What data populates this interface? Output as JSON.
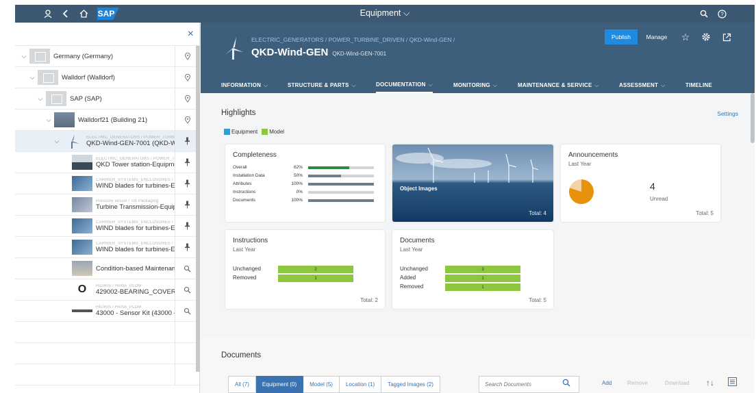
{
  "shell": {
    "title": "Equipment",
    "logo": "SAP",
    "icons": [
      "user-icon",
      "back-icon",
      "home-icon",
      "search-icon",
      "help-icon"
    ]
  },
  "tree": {
    "close": "×",
    "rows": [
      {
        "sub": "",
        "label": "Germany (Germany)",
        "action": "location-pin-icon"
      },
      {
        "sub": "",
        "label": "Walldorf (Walldorf)",
        "action": "location-pin-icon"
      },
      {
        "sub": "",
        "label": "SAP (SAP)",
        "action": "location-pin-icon"
      },
      {
        "sub": "",
        "label": "Walldorf21 (Building 21)",
        "action": "location-pin-icon"
      },
      {
        "sub": "ELECTRIC_GENERATORS / POWER_TURBI",
        "label": "QKD-Wind-GEN-7001 (QKD-Wi",
        "action": "unpin-icon"
      },
      {
        "sub": "ELECTRIC_GENERATORS / POWER_TUR",
        "label": "QKD Tower station-Equipme",
        "action": "unpin-icon"
      },
      {
        "sub": "CARRIER_SYSTEMS_ENCLOSURES / PR",
        "label": "WIND blades for turbines-Ec",
        "action": "unpin-icon"
      },
      {
        "sub": "Pressure vessel / Tilt Packaging",
        "label": "Turbine Transmission-Equipr",
        "action": "unpin-icon"
      },
      {
        "sub": "CARRIER_SYSTEMS_ENCLOSURES / PR",
        "label": "WIND blades for turbines-Ec",
        "action": "unpin-icon"
      },
      {
        "sub": "CARRIER_SYSTEMS_ENCLOSURES / PR",
        "label": "WIND blades for turbines-Ec",
        "action": "unpin-icon"
      },
      {
        "sub": "",
        "label": "Condition-based Maintenanc",
        "action": "search-icon"
      },
      {
        "sub": "HILIRIS / HANA_PLDM",
        "label": "429002-BEARING_COVER (",
        "action": "search-icon"
      },
      {
        "sub": "HILIRIS / HANA_PLDM",
        "label": "43000 - Sensor Kit (43000 -",
        "action": "search-icon"
      }
    ]
  },
  "object": {
    "breadcrumb": "ELECTRIC_GENERATORS / POWER_TURBINE_DRIVEN / QKD-Wind-GEN /",
    "title": "QKD-Wind-GEN",
    "subtitle": "QKD-Wind-GEN-7001",
    "publish": "Publish",
    "manage": "Manage",
    "tabs": [
      {
        "label": "INFORMATION",
        "dropdown": true
      },
      {
        "label": "STRUCTURE & PARTS",
        "dropdown": true
      },
      {
        "label": "DOCUMENTATION",
        "dropdown": true,
        "active": true
      },
      {
        "label": "MONITORING",
        "dropdown": true
      },
      {
        "label": "MAINTENANCE & SERVICE",
        "dropdown": true
      },
      {
        "label": "ASSESSMENT",
        "dropdown": true
      },
      {
        "label": "TIMELINE",
        "dropdown": false
      }
    ]
  },
  "highlights": {
    "title": "Highlights",
    "settings": "Settings",
    "legend": [
      {
        "label": "Equipment",
        "color": "#2c9fd9"
      },
      {
        "label": "Model",
        "color": "#8dc63f"
      }
    ]
  },
  "completeness": {
    "title": "Completeness",
    "rows": [
      {
        "label": "Overall",
        "pct": "62%",
        "fraction": 0.62,
        "color": "#2b8a3e"
      },
      {
        "label": "Installation Data",
        "pct": "50%",
        "fraction": 0.5,
        "color": "#6f7d88"
      },
      {
        "label": "Attributes",
        "pct": "100%",
        "fraction": 1.0,
        "color": "#6f7d88"
      },
      {
        "label": "Instructions",
        "pct": "0%",
        "fraction": 0.0,
        "color": "#6f7d88"
      },
      {
        "label": "Documents",
        "pct": "100%",
        "fraction": 1.0,
        "color": "#6f7d88"
      }
    ]
  },
  "images": {
    "label": "Object Images",
    "total": "Total: 4"
  },
  "announcements": {
    "title": "Announcements",
    "sub": "Last Year",
    "count": "4",
    "count_label": "Unread",
    "total": "Total: 5",
    "unread_fraction": 0.8,
    "colors": {
      "unread": "#e8920c",
      "read": "#f3d3a3"
    }
  },
  "instructions": {
    "title": "Instructions",
    "sub": "Last Year",
    "rows": [
      {
        "label": "Unchanged",
        "value": "2"
      },
      {
        "label": "Removed",
        "value": "1"
      }
    ],
    "total": "Total: 2"
  },
  "documents_card": {
    "title": "Documents",
    "sub": "Last Year",
    "rows": [
      {
        "label": "Unchanged",
        "value": "3"
      },
      {
        "label": "Added",
        "value": "1"
      },
      {
        "label": "Removed",
        "value": "1"
      }
    ],
    "total": "Total: 5"
  },
  "documents": {
    "title": "Documents",
    "filters": [
      {
        "label": "All (7)"
      },
      {
        "label": "Equipment (0)",
        "active": true
      },
      {
        "label": "Model (5)"
      },
      {
        "label": "Location (1)"
      },
      {
        "label": "Tagged Images (2)"
      }
    ],
    "search_placeholder": "Search Documents",
    "add": "Add",
    "remove": "Remove",
    "download": "Download"
  }
}
